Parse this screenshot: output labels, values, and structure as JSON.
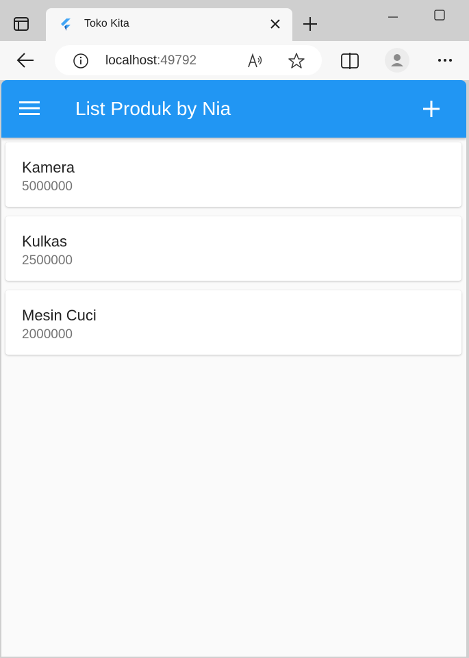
{
  "browser": {
    "tab_title": "Toko Kita",
    "url_host": "localhost",
    "url_port": ":49792"
  },
  "app": {
    "title": "List Produk by Nia",
    "primary_color": "#2196f3"
  },
  "products": [
    {
      "name": "Kamera",
      "price": "5000000"
    },
    {
      "name": "Kulkas",
      "price": "2500000"
    },
    {
      "name": "Mesin Cuci",
      "price": "2000000"
    }
  ],
  "icons": {
    "tab_actions": "tab-actions-icon",
    "favicon": "flutter-icon",
    "close": "close-icon",
    "new_tab": "plus-icon",
    "minimize": "minimize-icon",
    "maximize": "maximize-icon",
    "back": "arrow-left-icon",
    "info": "info-icon",
    "read_aloud": "read-aloud-icon",
    "favorite": "star-icon",
    "split": "split-screen-icon",
    "profile": "profile-icon",
    "more": "more-icon",
    "menu": "hamburger-menu-icon",
    "add": "add-icon"
  }
}
